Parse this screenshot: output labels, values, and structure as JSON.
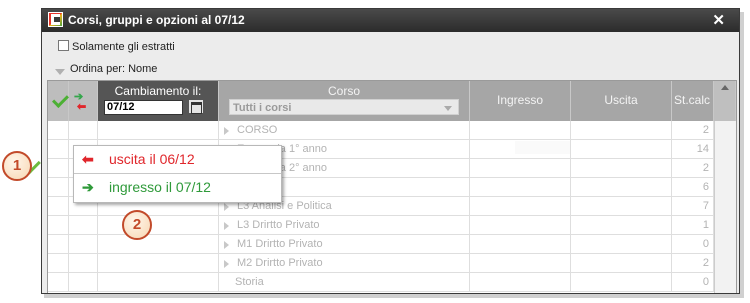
{
  "window": {
    "title": "Corsi, gruppi e opzioni al 07/12",
    "close_symbol": "✕"
  },
  "filter": {
    "only_extracted_label": "Solamente gli estratti",
    "only_extracted_checked": false
  },
  "sort": {
    "label": "Ordina per: Nome"
  },
  "grid": {
    "headers": {
      "cambiamento": "Cambiamento il:",
      "cambiamento_date": "07/12",
      "corso": "Corso",
      "corso_filter": "Tutti i corsi",
      "ingresso": "Ingresso",
      "uscita": "Uscita",
      "stcalc": "St.calc"
    },
    "rows": [
      {
        "name": "CORSO",
        "stcalc": "2"
      },
      {
        "name": "Economia 1° anno",
        "stcalc": "14"
      },
      {
        "name": "Economia 2° anno",
        "stcalc": "2"
      },
      {
        "name": "",
        "stcalc": "6"
      },
      {
        "name": "L3 Analisi e Politica",
        "stcalc": "7"
      },
      {
        "name": "L3 Drirtto Privato",
        "stcalc": "1"
      },
      {
        "name": "M1 Drirtto Privato",
        "stcalc": "0"
      },
      {
        "name": "M2 Drirtto Privato",
        "stcalc": "2"
      },
      {
        "name": "Storia",
        "stcalc": "0"
      }
    ]
  },
  "popup": {
    "uscita_label": "uscita il 06/12",
    "ingresso_label": "ingresso il 07/12"
  },
  "callouts": {
    "one": "1",
    "two": "2"
  },
  "colors": {
    "accent_green": "#34a64b",
    "accent_red": "#e0262b",
    "callout_border": "#c24a2a"
  }
}
